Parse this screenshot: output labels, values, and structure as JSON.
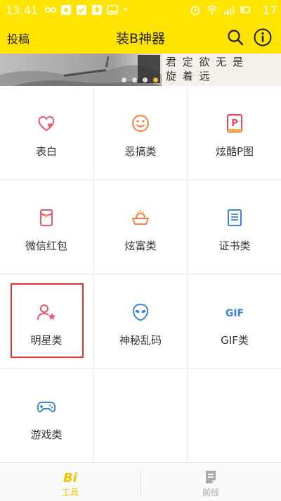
{
  "status_bar": {
    "time": "13:41",
    "battery": "17"
  },
  "header": {
    "left_button": "投稿",
    "title": "装B神器"
  },
  "banner": {
    "poem_lines": [
      "君  定  欲  无  是",
      "    旋  着  远"
    ],
    "active_slide": 3,
    "slide_count": 4
  },
  "grid": {
    "items": [
      {
        "label": "表白",
        "icon": "heart-icon",
        "color": "#f0566a"
      },
      {
        "label": "恶搞类",
        "icon": "funny-face-icon",
        "color": "#f5813f"
      },
      {
        "label": "炫酷P图",
        "icon": "p-photo-icon",
        "color": "#e9475b"
      },
      {
        "label": "微信红包",
        "icon": "red-packet-icon",
        "color": "#f0566a"
      },
      {
        "label": "炫富类",
        "icon": "gold-ingot-icon",
        "color": "#f5813f"
      },
      {
        "label": "证书类",
        "icon": "certificate-icon",
        "color": "#3a86d4"
      },
      {
        "label": "明星类",
        "icon": "star-person-icon",
        "color": "#f0566a"
      },
      {
        "label": "神秘乱码",
        "icon": "alien-icon",
        "color": "#3a86d4"
      },
      {
        "label": "GIF类",
        "icon": "gif-icon",
        "color": "#3a86d4"
      },
      {
        "label": "游戏类",
        "icon": "gamepad-icon",
        "color": "#3a86d4"
      }
    ],
    "selected_item": "明星类"
  },
  "bottom_nav": {
    "tabs": [
      {
        "label": "工具",
        "icon": "bi-tools-icon",
        "active": true
      },
      {
        "label": "前线",
        "icon": "document-icon",
        "active": false
      }
    ]
  },
  "colors": {
    "accent": "#ffe400",
    "active_tab": "#f2c500",
    "inactive_tab": "#a8a8a8",
    "selection_border": "#e53030"
  }
}
